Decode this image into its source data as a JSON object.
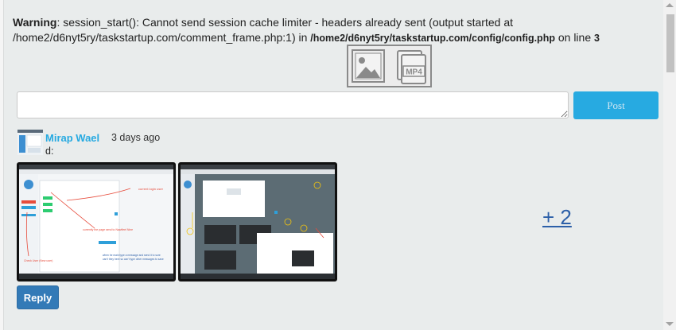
{
  "warning": {
    "label": "Warning",
    "message_part1": ": session_start(): Cannot send session cache limiter - headers already sent (output started at /home2/d6nyt5ry/taskstartup.com/comment_frame.php:1) in ",
    "file_path": "/home2/d6nyt5ry/taskstartup.com/config/config.php",
    "message_part2": " on line ",
    "line_number": "3"
  },
  "composer": {
    "comment_value": "",
    "post_label": "Post",
    "media_icons": [
      "image-icon",
      "mp4-icon"
    ]
  },
  "comment": {
    "author": "Mirap Wael",
    "time_ago": "3 days ago",
    "text": "d:",
    "more_count_label": "+ 2",
    "reply_label": "Reply",
    "attachments": [
      {
        "type": "screenshot",
        "annotations": [
          "current login user",
          "currently the page send to Nawfleel Nine",
          "when he main type a message and send it to sure can't they here so can't type other messages to save",
          "Check User (New user)"
        ]
      },
      {
        "type": "screenshot",
        "annotations": []
      }
    ]
  },
  "colors": {
    "accent": "#27aae1",
    "reply_button": "#337ab7",
    "more_link": "#2c5fa8",
    "background": "#e9ecec"
  }
}
